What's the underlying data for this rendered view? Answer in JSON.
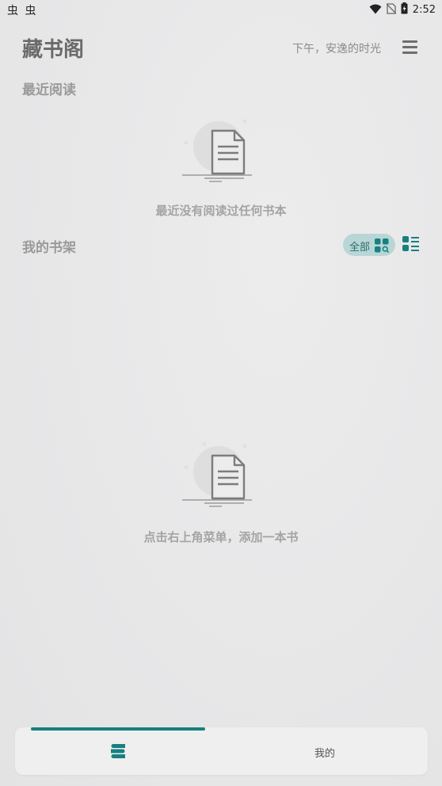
{
  "status_bar": {
    "left_text": "虫 虫",
    "time": "2:52",
    "icons": [
      "wifi-icon",
      "no-sim-icon",
      "battery-icon"
    ]
  },
  "header": {
    "title": "藏书阁",
    "greeting": "下午，安逸的时光",
    "menu_icon": "hamburger-menu-icon"
  },
  "recent": {
    "title": "最近阅读",
    "empty_text": "最近没有阅读过任何书本",
    "empty_icon": "document-icon"
  },
  "shelf": {
    "title": "我的书架",
    "filter_label": "全部",
    "filter_icon": "category-search-icon",
    "view_icon": "list-view-icon",
    "empty_text": "点击右上角菜单，添加一本书",
    "empty_icon": "document-icon"
  },
  "bottom_nav": {
    "tabs": [
      {
        "label": "",
        "icon": "bookshelf-icon",
        "active": true
      },
      {
        "label": "我的",
        "active": false
      }
    ]
  },
  "colors": {
    "accent": "#188080",
    "pill_bg": "#b9d6d6",
    "title": "#6a6a6a",
    "muted_text": "#a4a4a4"
  }
}
